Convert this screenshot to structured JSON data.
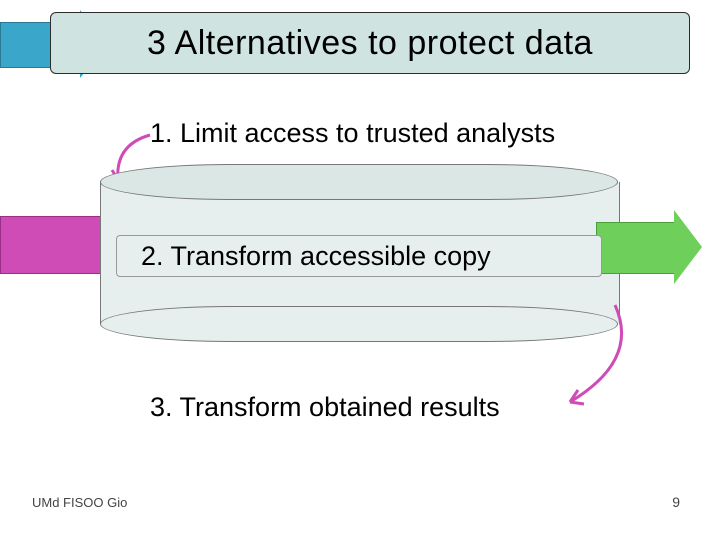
{
  "title": "3 Alternatives to protect data",
  "items": {
    "one": "1. Limit access to trusted analysts",
    "two": "2. Transform accessible copy",
    "three": "3. Transform obtained results"
  },
  "footer": {
    "left": "UMd FISOO  Gio",
    "page": "9"
  }
}
